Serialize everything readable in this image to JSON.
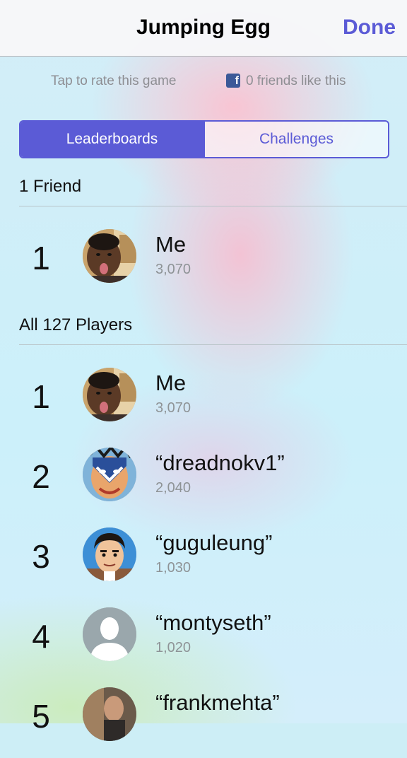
{
  "navbar": {
    "title": "Jumping Egg",
    "done_label": "Done"
  },
  "meta": {
    "rate_text": "Tap to rate this game",
    "likes_text": "0 friends like this",
    "likes_icon": "facebook-icon"
  },
  "tabs": [
    {
      "label": "Leaderboards",
      "active": true
    },
    {
      "label": "Challenges",
      "active": false
    }
  ],
  "friends_section": {
    "header": "1 Friend",
    "rows": [
      {
        "rank": "1",
        "name": "Me",
        "score": "3,070",
        "avatar": "selfie-avatar"
      }
    ]
  },
  "all_section": {
    "header": "All 127 Players",
    "rows": [
      {
        "rank": "1",
        "name": "Me",
        "score": "3,070",
        "avatar": "selfie-avatar"
      },
      {
        "rank": "2",
        "name": "“dreadnokv1”",
        "score": "2,040",
        "avatar": "painted-mask-avatar"
      },
      {
        "rank": "3",
        "name": "“guguleung”",
        "score": "1,030",
        "avatar": "cartoon-man-avatar"
      },
      {
        "rank": "4",
        "name": "“montyseth”",
        "score": "1,020",
        "avatar": "default-silhouette-avatar"
      },
      {
        "rank": "5",
        "name": "“frankmehta”",
        "score": "",
        "avatar": "photo-avatar"
      }
    ]
  },
  "colors": {
    "accent": "#5b5bd6",
    "facebook": "#3b5998"
  }
}
